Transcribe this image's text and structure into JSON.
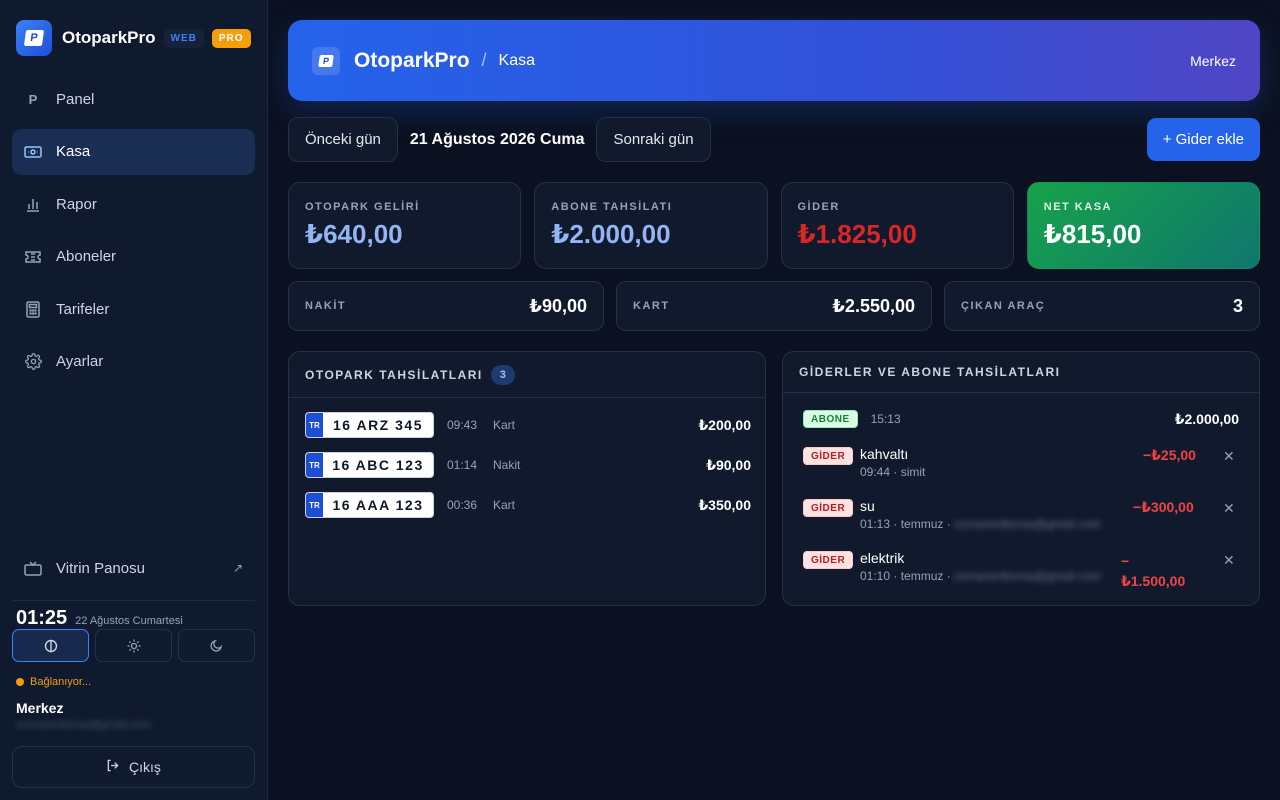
{
  "sidebar": {
    "brand": "OtoparkPro",
    "badge_web": "WEB",
    "badge_pro": "PRO",
    "nav": [
      {
        "label": "Panel",
        "icon": "P"
      },
      {
        "label": "Kasa",
        "icon": "cash-icon"
      },
      {
        "label": "Rapor",
        "icon": "bar-chart-icon"
      },
      {
        "label": "Aboneler",
        "icon": "ticket-icon"
      },
      {
        "label": "Tarifeler",
        "icon": "calculator-icon"
      },
      {
        "label": "Ayarlar",
        "icon": "gear-icon"
      }
    ],
    "vitrin": "Vitrin Panosu",
    "clock_time": "01:25",
    "clock_date": "22 Ağustos Cumartesi",
    "connection": "Bağlanıyor...",
    "user_name": "Merkez",
    "user_email": "ozmanertborsa@gmail.com",
    "logout": "Çıkış"
  },
  "header": {
    "brand": "OtoparkPro",
    "separator": "/",
    "page": "Kasa",
    "location": "Merkez"
  },
  "toolbar": {
    "prev": "Önceki gün",
    "date": "21 Ağustos 2026 Cuma",
    "next": "Sonraki gün",
    "add_expense": "+ Gider ekle"
  },
  "stats": [
    {
      "label": "OTOPARK GELİRİ",
      "value": "₺640,00",
      "color": "#93b4f5"
    },
    {
      "label": "ABONE TAHSİLATI",
      "value": "₺2.000,00",
      "color": "#93b4f5"
    },
    {
      "label": "GİDER",
      "value": "₺1.825,00",
      "color": "#dc2626"
    },
    {
      "label": "NET KASA",
      "value": "₺815,00",
      "color": "#ffffff"
    }
  ],
  "minis": [
    {
      "label": "NAKİT",
      "value": "₺90,00"
    },
    {
      "label": "KART",
      "value": "₺2.550,00"
    },
    {
      "label": "ÇIKAN ARAÇ",
      "value": "3"
    }
  ],
  "parking": {
    "title": "OTOPARK TAHSİLATLARI",
    "count": "3",
    "rows": [
      {
        "tr": "TR",
        "plate": "16 ARZ 345",
        "time": "09:43",
        "method": "Kart",
        "amount": "₺200,00"
      },
      {
        "tr": "TR",
        "plate": "16 ABC 123",
        "time": "01:14",
        "method": "Nakit",
        "amount": "₺90,00"
      },
      {
        "tr": "TR",
        "plate": "16 AAA 123",
        "time": "00:36",
        "method": "Kart",
        "amount": "₺350,00"
      }
    ]
  },
  "expenses": {
    "title": "GİDERLER VE ABONE TAHSİLATLARI",
    "abone": {
      "tag": "ABONE",
      "time": "15:13",
      "amount": "₺2.000,00"
    },
    "items": [
      {
        "tag": "GİDER",
        "title": "kahvaltı",
        "sub": "09:44 · simit",
        "email": "",
        "amount": "−₺25,00"
      },
      {
        "tag": "GİDER",
        "title": "su",
        "sub": "01:13 · temmuz · ",
        "email": "ozmanertborsa@gmail.com",
        "amount": "−₺300,00"
      },
      {
        "tag": "GİDER",
        "title": "elektrik",
        "sub": "01:10 · temmuz · ",
        "email": "ozmanertborsa@gmail.com",
        "amount_line1": "−",
        "amount_line2": "₺1.500,00"
      }
    ]
  }
}
